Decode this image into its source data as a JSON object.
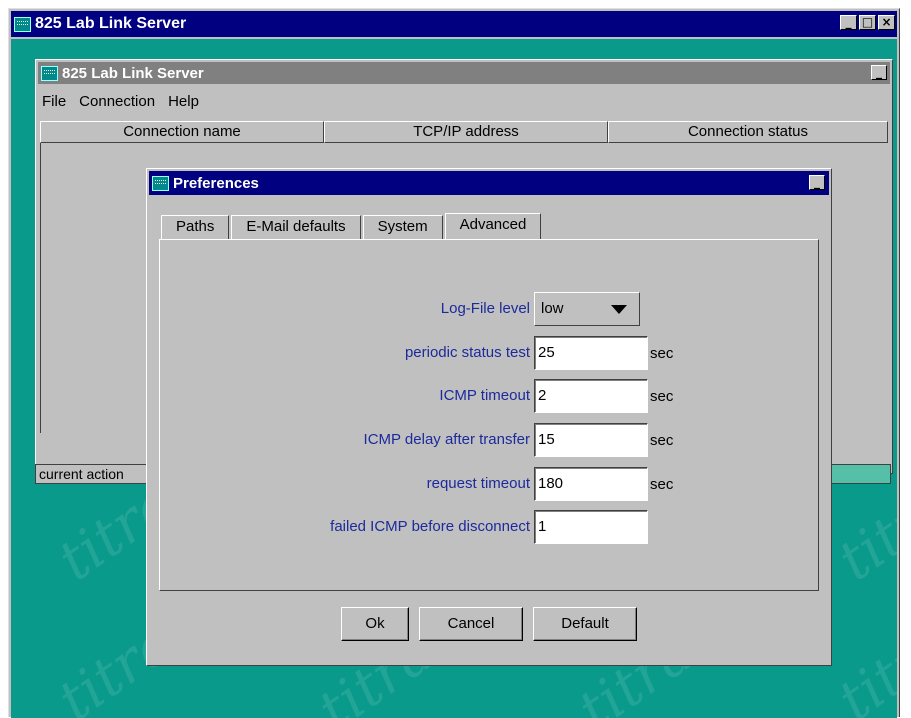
{
  "window": {
    "title": "825 Lab Link Server",
    "controls": [
      "minimize-icon",
      "maximize-icon",
      "close-icon"
    ]
  },
  "inner_window": {
    "title": "825 Lab Link Server",
    "menu": [
      "File",
      "Connection",
      "Help"
    ],
    "columns": [
      "Connection name",
      "TCP/IP address",
      "Connection status"
    ],
    "status_text": "current action"
  },
  "desktop": {
    "watermark": "titran"
  },
  "dialog": {
    "title": "Preferences",
    "tabs": [
      "Paths",
      "E-Mail defaults",
      "System",
      "Advanced"
    ],
    "active_tab": "Advanced",
    "fields": [
      {
        "label": "Log-File level",
        "value": "low",
        "unit": ""
      },
      {
        "label": "periodic status test",
        "value": "25",
        "unit": "sec"
      },
      {
        "label": "ICMP timeout",
        "value": "2",
        "unit": "sec"
      },
      {
        "label": "ICMP delay after transfer",
        "value": "15",
        "unit": "sec"
      },
      {
        "label": "request timeout",
        "value": "180",
        "unit": "sec"
      },
      {
        "label": "failed ICMP before disconnect",
        "value": "1",
        "unit": ""
      }
    ],
    "buttons": {
      "ok": "Ok",
      "cancel": "Cancel",
      "default": "Default"
    }
  },
  "colors": {
    "title_active": "#000080",
    "title_inactive": "#808080",
    "desktop": "#0a9a8c",
    "label_text": "#1c2a9c",
    "face": "#c0c0c0"
  }
}
